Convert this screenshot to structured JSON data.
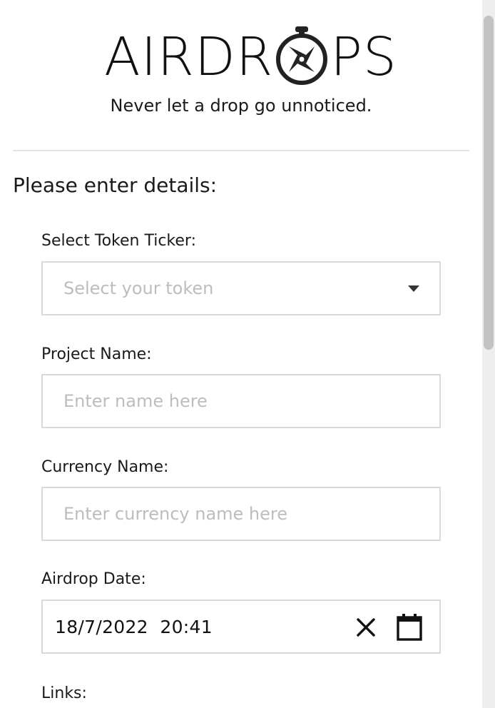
{
  "brand": {
    "logo_left": "AIRDR",
    "logo_right": "PS",
    "logo_icon": "compass-icon",
    "tagline": "Never let a drop go unnoticed."
  },
  "form": {
    "heading": "Please enter details:",
    "token": {
      "label": "Select Token Ticker:",
      "placeholder": "Select your token"
    },
    "project": {
      "label": "Project Name:",
      "placeholder": "Enter name here"
    },
    "currency": {
      "label": "Currency Name:",
      "placeholder": "Enter currency name here"
    },
    "date": {
      "label": "Airdrop Date:",
      "value": "18/7/2022  20:41",
      "clear_icon": "close-icon",
      "picker_icon": "calendar-icon"
    },
    "links": {
      "label": "Links:"
    }
  },
  "colors": {
    "text": "#1a1a1a",
    "border": "#dadada",
    "placeholder": "#bdbdbd",
    "divider": "#e2e2e2",
    "scroll_thumb": "#c2c2c2",
    "scroll_track": "#eeeeee"
  }
}
